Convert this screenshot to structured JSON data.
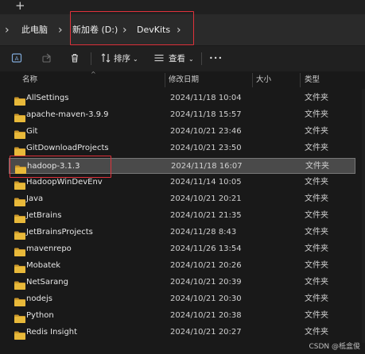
{
  "tabstrip": {
    "new_tab_label": "+"
  },
  "breadcrumb": {
    "items": [
      "此电脑",
      "新加卷 (D:)",
      "DevKits"
    ]
  },
  "toolbar": {
    "sort_label": "排序",
    "view_label": "查看",
    "more_label": "•••"
  },
  "columns": {
    "name": "名称",
    "modified": "修改日期",
    "size": "大小",
    "type": "类型"
  },
  "files": [
    {
      "name": "AllSettings",
      "modified": "2024/11/18 10:04",
      "type": "文件夹"
    },
    {
      "name": "apache-maven-3.9.9",
      "modified": "2024/11/18 15:57",
      "type": "文件夹"
    },
    {
      "name": "Git",
      "modified": "2024/10/21 23:46",
      "type": "文件夹"
    },
    {
      "name": "GitDownloadProjects",
      "modified": "2024/10/21 23:50",
      "type": "文件夹"
    },
    {
      "name": "hadoop-3.1.3",
      "modified": "2024/11/18 16:07",
      "type": "文件夹",
      "selected": true
    },
    {
      "name": "HadoopWinDevEnv",
      "modified": "2024/11/14 10:05",
      "type": "文件夹"
    },
    {
      "name": "Java",
      "modified": "2024/10/21 20:21",
      "type": "文件夹"
    },
    {
      "name": "JetBrains",
      "modified": "2024/10/21 21:35",
      "type": "文件夹"
    },
    {
      "name": "JetBrainsProjects",
      "modified": "2024/11/28 8:43",
      "type": "文件夹"
    },
    {
      "name": "mavenrepo",
      "modified": "2024/11/26 13:54",
      "type": "文件夹"
    },
    {
      "name": "Mobatek",
      "modified": "2024/10/21 20:26",
      "type": "文件夹"
    },
    {
      "name": "NetSarang",
      "modified": "2024/10/21 20:39",
      "type": "文件夹"
    },
    {
      "name": "nodejs",
      "modified": "2024/10/21 20:30",
      "type": "文件夹"
    },
    {
      "name": "Python",
      "modified": "2024/10/21 20:38",
      "type": "文件夹"
    },
    {
      "name": "Redis Insight",
      "modified": "2024/10/21 20:27",
      "type": "文件夹"
    }
  ],
  "watermark": "CSDN @柢盒俊",
  "colors": {
    "folder": "#e8b93a",
    "folder_dark": "#c9962a",
    "highlight_box": "#e0323b",
    "selected_row": "#4a4a4a"
  }
}
